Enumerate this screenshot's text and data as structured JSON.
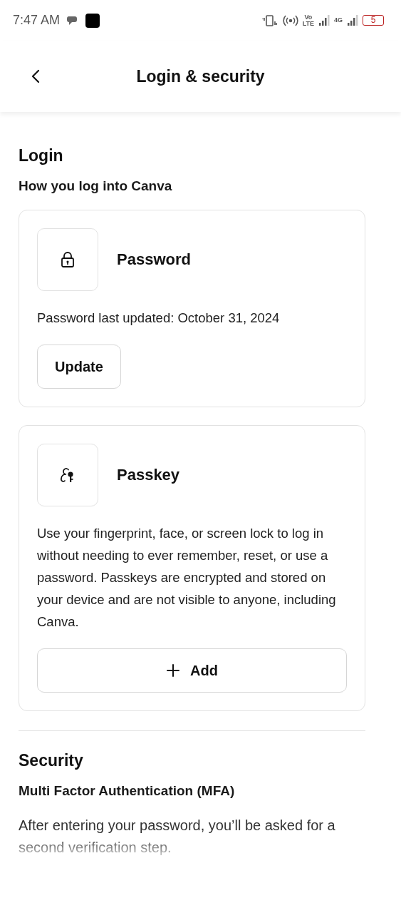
{
  "status_bar": {
    "time": "7:47 AM",
    "network_labels": [
      "Vo",
      "LTE",
      "4G"
    ],
    "battery": "5"
  },
  "header": {
    "title": "Login & security"
  },
  "sections": [
    {
      "title": "Login",
      "subtitle": "How you log into Canva",
      "cards": [
        {
          "kind": "password",
          "title": "Password",
          "text": "Password last updated: October 31, 2024",
          "button": {
            "label": "Update",
            "kind": "compact"
          }
        },
        {
          "kind": "passkey",
          "title": "Passkey",
          "text": "Use your fingerprint, face, or screen lock to log in without needing to ever remember, reset, or use a password. Passkeys are encrypted and stored on your device and are not visible to anyone, including Canva.",
          "button": {
            "label": "Add",
            "kind": "wide"
          }
        }
      ]
    },
    {
      "title": "Security",
      "subtitle": "Multi Factor Authentication (MFA)",
      "text": "After entering your password, you’ll be asked for a second verification step."
    }
  ]
}
